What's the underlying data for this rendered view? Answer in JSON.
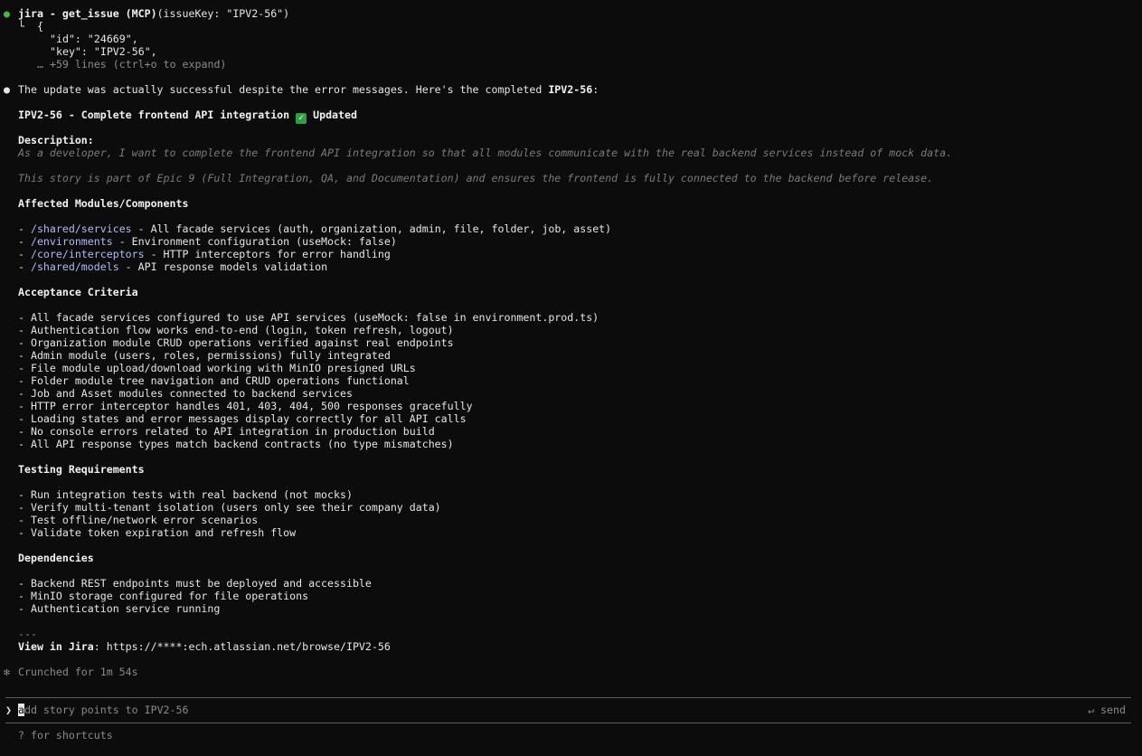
{
  "tool_call": {
    "name": "jira - get_issue (MCP)",
    "args": "(issueKey: \"IPV2-56\")",
    "open": "└  {",
    "id_line": "\"id\": \"24669\",",
    "key_line": "\"key\": \"IPV2-56\",",
    "more": "… +59 lines (ctrl+o to expand)"
  },
  "message": {
    "intro": "The update was actually successful despite the error messages. Here's the completed ",
    "intro_key": "IPV2-56",
    "intro_end": ":",
    "title": "IPV2-56 - Complete frontend API integration ",
    "title_status": "Updated",
    "description_heading": "Description:",
    "description_1": "As a developer, I want to complete the frontend API integration so that all modules communicate with the real backend services instead of mock data.",
    "description_2": "This story is part of Epic 9 (Full Integration, QA, and Documentation) and ensures the frontend is fully connected to the backend before release.",
    "modules_heading": "Affected Modules/Components",
    "modules": [
      {
        "path": "/shared/services",
        "desc": " - All facade services (auth, organization, admin, file, folder, job, asset)"
      },
      {
        "path": "/environments",
        "desc": " - Environment configuration (useMock: false)"
      },
      {
        "path": "/core/interceptors",
        "desc": " - HTTP interceptors for error handling"
      },
      {
        "path": "/shared/models",
        "desc": " - API response models validation"
      }
    ],
    "acceptance_heading": "Acceptance Criteria",
    "acceptance": [
      "- All facade services configured to use API services (useMock: false in environment.prod.ts)",
      "- Authentication flow works end-to-end (login, token refresh, logout)",
      "- Organization module CRUD operations verified against real endpoints",
      "- Admin module (users, roles, permissions) fully integrated",
      "- File module upload/download working with MinIO presigned URLs",
      "- Folder module tree navigation and CRUD operations functional",
      "- Job and Asset modules connected to backend services",
      "- HTTP error interceptor handles 401, 403, 404, 500 responses gracefully",
      "- Loading states and error messages display correctly for all API calls",
      "- No console errors related to API integration in production build",
      "- All API response types match backend contracts (no type mismatches)"
    ],
    "testing_heading": "Testing Requirements",
    "testing": [
      "- Run integration tests with real backend (not mocks)",
      "- Verify multi-tenant isolation (users only see their company data)",
      "- Test offline/network error scenarios",
      "- Validate token expiration and refresh flow"
    ],
    "dependencies_heading": "Dependencies",
    "dependencies": [
      "- Backend REST endpoints must be deployed and accessible",
      "- MinIO storage configured for file operations",
      "- Authentication service running"
    ],
    "separator": "---",
    "view_label": "View in Jira",
    "view_url": ": https://****:ech.atlassian.net/browse/IPV2-56"
  },
  "status": {
    "icon": "✻",
    "text": "Crunched for 1m 54s"
  },
  "input": {
    "prompt_symbol": "❯",
    "caret_char": "a",
    "placeholder_rest": "dd story points to IPV2-56",
    "send_hint": "↵ send"
  },
  "footer": {
    "shortcuts": "? for shortcuts"
  },
  "colors": {
    "background": "#0c0c0c",
    "path": "#b1b9f9",
    "success": "#3fb950",
    "muted": "#8a8a8a"
  }
}
